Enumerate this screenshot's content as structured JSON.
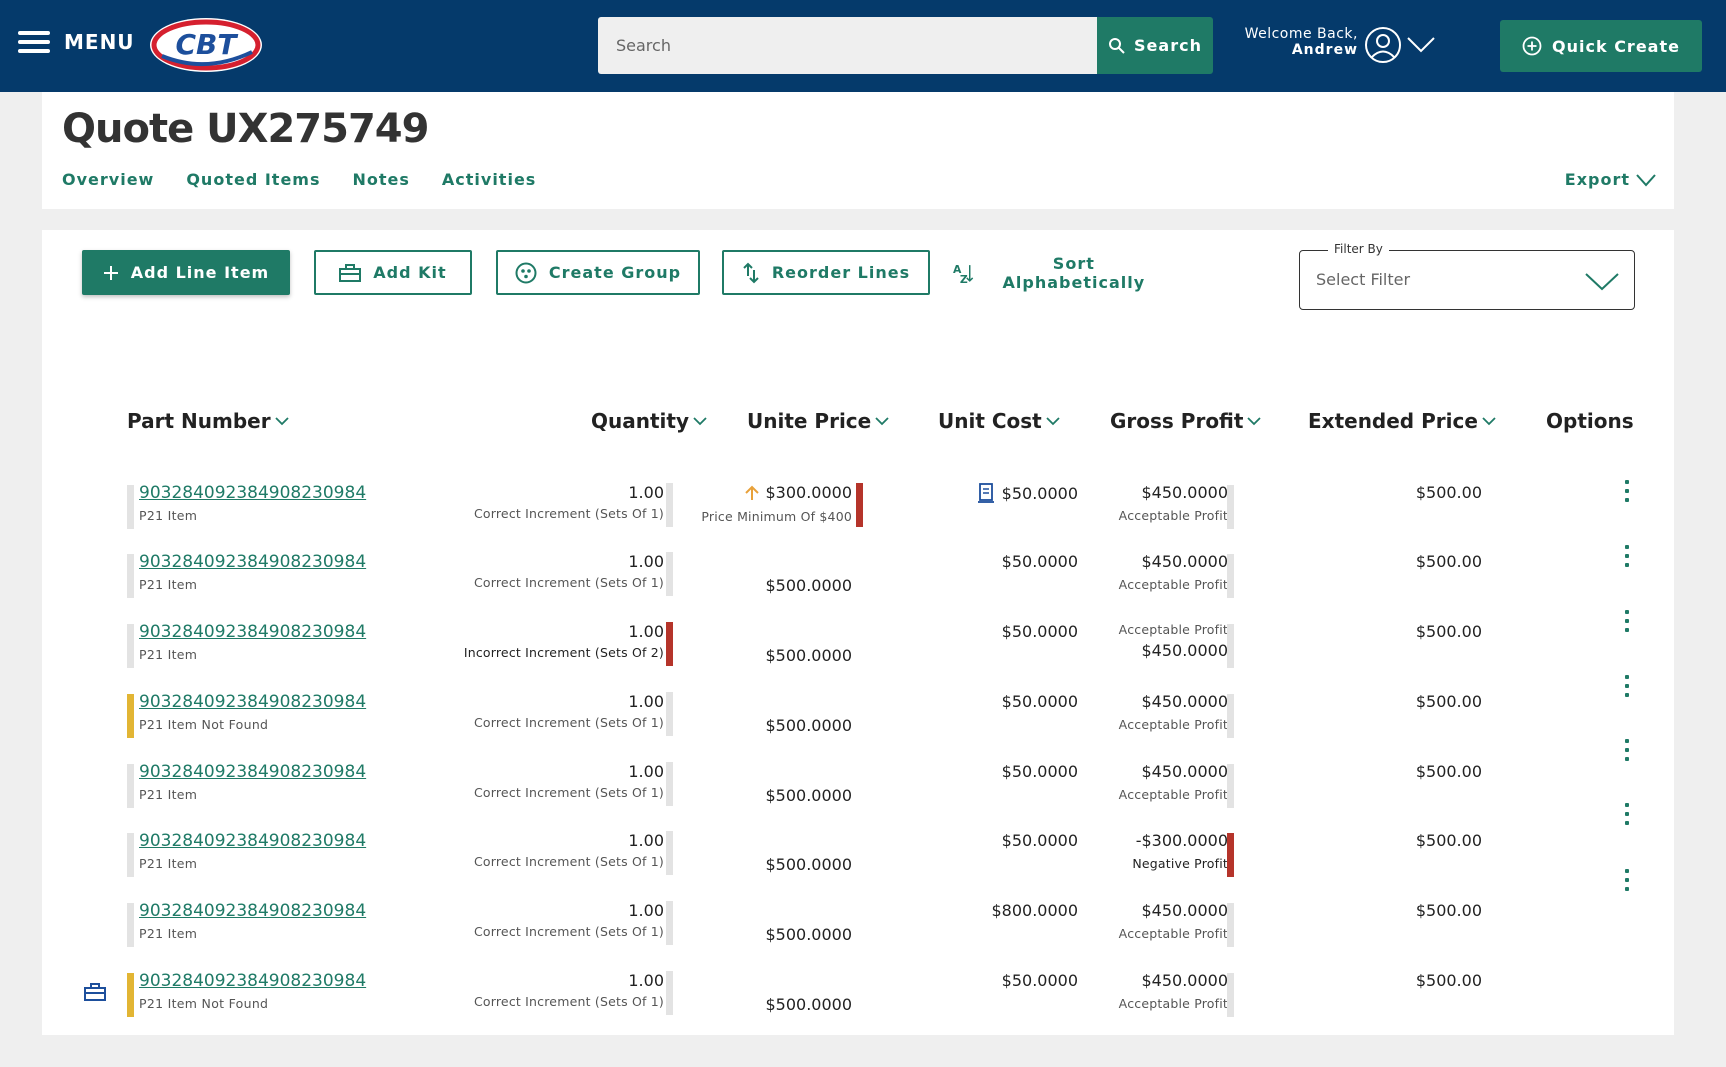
{
  "topbar": {
    "menu_label": "MENU",
    "logo_text": "CBT",
    "search_placeholder": "Search",
    "search_button_label": "Search",
    "welcome_line1": "Welcome Back,",
    "welcome_name": "Andrew",
    "quick_create_label": "Quick Create"
  },
  "quote": {
    "title": "Quote UX275749",
    "tabs": [
      "Overview",
      "Quoted Items",
      "Notes",
      "Activities"
    ],
    "export_label": "Export"
  },
  "toolbar": {
    "add_line_item_label": "Add Line Item",
    "add_kit_label": "Add Kit",
    "create_group_label": "Create Group",
    "reorder_lines_label": "Reorder Lines",
    "sort_alphabetically_label": "Sort Alphabetically",
    "filter_legend": "Filter By",
    "filter_value": "Select Filter"
  },
  "table": {
    "columns": {
      "part_number": "Part Number",
      "quantity": "Quantity",
      "unit_price": "Unite Price",
      "unit_cost": "Unit Cost",
      "gross_profit": "Gross Profit",
      "extended_price": "Extended Price",
      "options": "Options"
    },
    "rows": [
      {
        "part": "903284092384908230984",
        "part_sub": "P21 Item",
        "qty": "1.00",
        "qty_note": "Correct Increment (Sets Of 1)",
        "price": "$300.0000",
        "price_note": "Price Minimum Of $400",
        "cost": "$50.0000",
        "gp": "$450.0000",
        "gp_note": "Acceptable Profit",
        "ext": "$500.00"
      },
      {
        "part": "903284092384908230984",
        "part_sub": "P21 Item",
        "qty": "1.00",
        "qty_note": "Correct Increment (Sets Of 1)",
        "price": "$500.0000",
        "cost": "$50.0000",
        "gp": "$450.0000",
        "gp_note": "Acceptable Profit",
        "ext": "$500.00"
      },
      {
        "part": "903284092384908230984",
        "part_sub": "P21 Item",
        "qty": "1.00",
        "qty_note": "Incorrect Increment (Sets Of 2)",
        "price": "$500.0000",
        "cost": "$50.0000",
        "gp": "$450.0000",
        "gp_note": "Acceptable Profit",
        "ext": "$500.00"
      },
      {
        "part": "903284092384908230984",
        "part_sub": "P21 Item Not Found",
        "qty": "1.00",
        "qty_note": "Correct Increment (Sets Of 1)",
        "price": "$500.0000",
        "cost": "$50.0000",
        "gp": "$450.0000",
        "gp_note": "Acceptable Profit",
        "ext": "$500.00"
      },
      {
        "part": "903284092384908230984",
        "part_sub": "P21 Item",
        "qty": "1.00",
        "qty_note": "Correct Increment (Sets Of 1)",
        "price": "$500.0000",
        "cost": "$50.0000",
        "gp": "$450.0000",
        "gp_note": "Acceptable Profit",
        "ext": "$500.00"
      },
      {
        "part": "903284092384908230984",
        "part_sub": "P21 Item",
        "qty": "1.00",
        "qty_note": "Correct Increment (Sets Of 1)",
        "price": "$500.0000",
        "cost": "$50.0000",
        "gp": "-$300.0000",
        "gp_note": "Negative Profit",
        "ext": "$500.00"
      },
      {
        "part": "903284092384908230984",
        "part_sub": "P21 Item",
        "qty": "1.00",
        "qty_note": "Correct Increment (Sets Of 1)",
        "price": "$500.0000",
        "cost": "$800.0000",
        "gp": "$450.0000",
        "gp_note": "Acceptable Profit",
        "ext": "$500.00"
      },
      {
        "part": "903284092384908230984",
        "part_sub": "P21 Item Not Found",
        "qty": "1.00",
        "qty_note": "Correct Increment (Sets Of 1)",
        "price": "$500.0000",
        "cost": "$50.0000",
        "gp": "$450.0000",
        "gp_note": "Acceptable Profit",
        "ext": "$500.00"
      }
    ]
  },
  "colors": {
    "navy": "#053a6b",
    "teal": "#1f7a66",
    "error_red": "#b5342a",
    "warning_yellow": "#e2b534",
    "up_arrow_orange": "#e8a13a"
  },
  "icons": [
    "menu-icon",
    "search-icon",
    "user-avatar-icon",
    "chevron-down-icon",
    "plus-circle-icon",
    "plus-icon",
    "toolbox-icon",
    "group-icon",
    "reorder-icon",
    "sort-az-icon",
    "arrow-up-icon",
    "receipt-icon",
    "kebab-icon",
    "kit-icon"
  ]
}
